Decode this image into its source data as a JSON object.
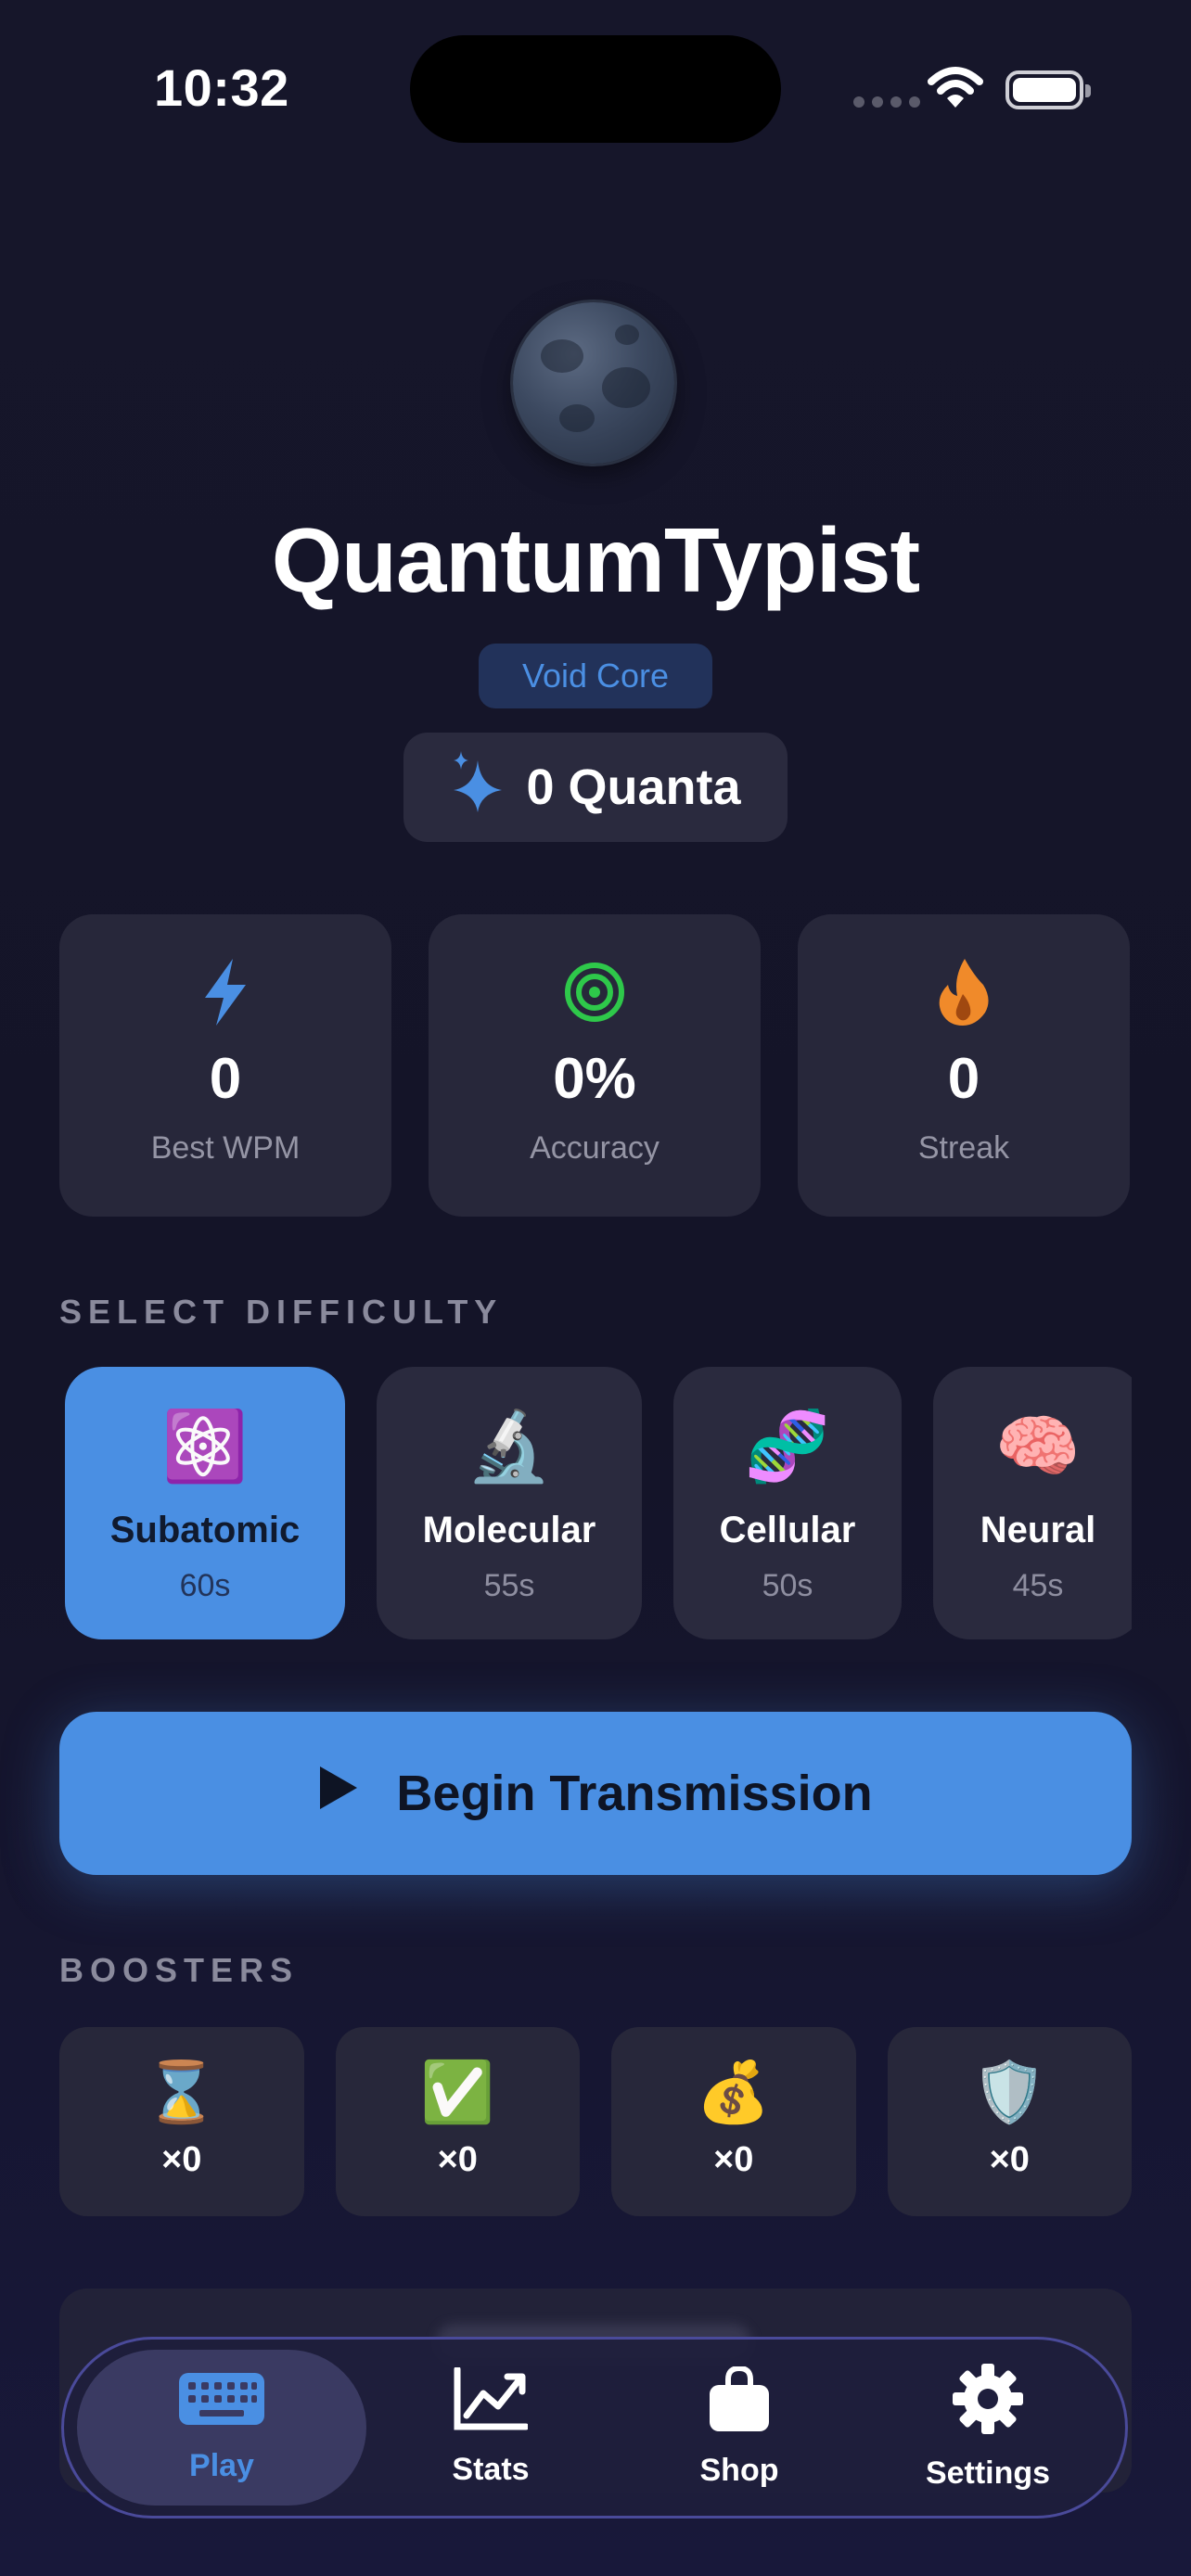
{
  "status_bar": {
    "time": "10:32"
  },
  "profile": {
    "username": "QuantumTypist",
    "rank": "Void Core",
    "quanta": "0 Quanta"
  },
  "stats": [
    {
      "icon": "lightning-icon",
      "value": "0",
      "label": "Best WPM",
      "color": "#4a8fe3"
    },
    {
      "icon": "target-icon",
      "value": "0%",
      "label": "Accuracy",
      "color": "#2ec84a"
    },
    {
      "icon": "flame-icon",
      "value": "0",
      "label": "Streak",
      "color": "#f08a2a"
    }
  ],
  "difficulty": {
    "section_label": "SELECT DIFFICULTY",
    "selected": "Subatomic",
    "options": [
      {
        "emoji": "⚛️",
        "name": "Subatomic",
        "time": "60s"
      },
      {
        "emoji": "🔬",
        "name": "Molecular",
        "time": "55s"
      },
      {
        "emoji": "🧬",
        "name": "Cellular",
        "time": "50s"
      },
      {
        "emoji": "🧠",
        "name": "Neural",
        "time": "45s"
      }
    ]
  },
  "begin_button": {
    "label": "Begin Transmission"
  },
  "boosters": {
    "section_label": "BOOSTERS",
    "items": [
      {
        "emoji": "⌛",
        "count": "×0"
      },
      {
        "emoji": "✅",
        "count": "×0"
      },
      {
        "emoji": "💰",
        "count": "×0"
      },
      {
        "emoji": "🛡️",
        "count": "×0"
      }
    ]
  },
  "tabbar": {
    "active": "Play",
    "tabs": [
      {
        "icon": "keyboard-icon",
        "label": "Play"
      },
      {
        "icon": "chart-icon",
        "label": "Stats"
      },
      {
        "icon": "bag-icon",
        "label": "Shop"
      },
      {
        "icon": "gear-icon",
        "label": "Settings"
      }
    ]
  },
  "colors": {
    "accent": "#4a8fe3",
    "background": "#16162a",
    "card": "#27273a"
  }
}
